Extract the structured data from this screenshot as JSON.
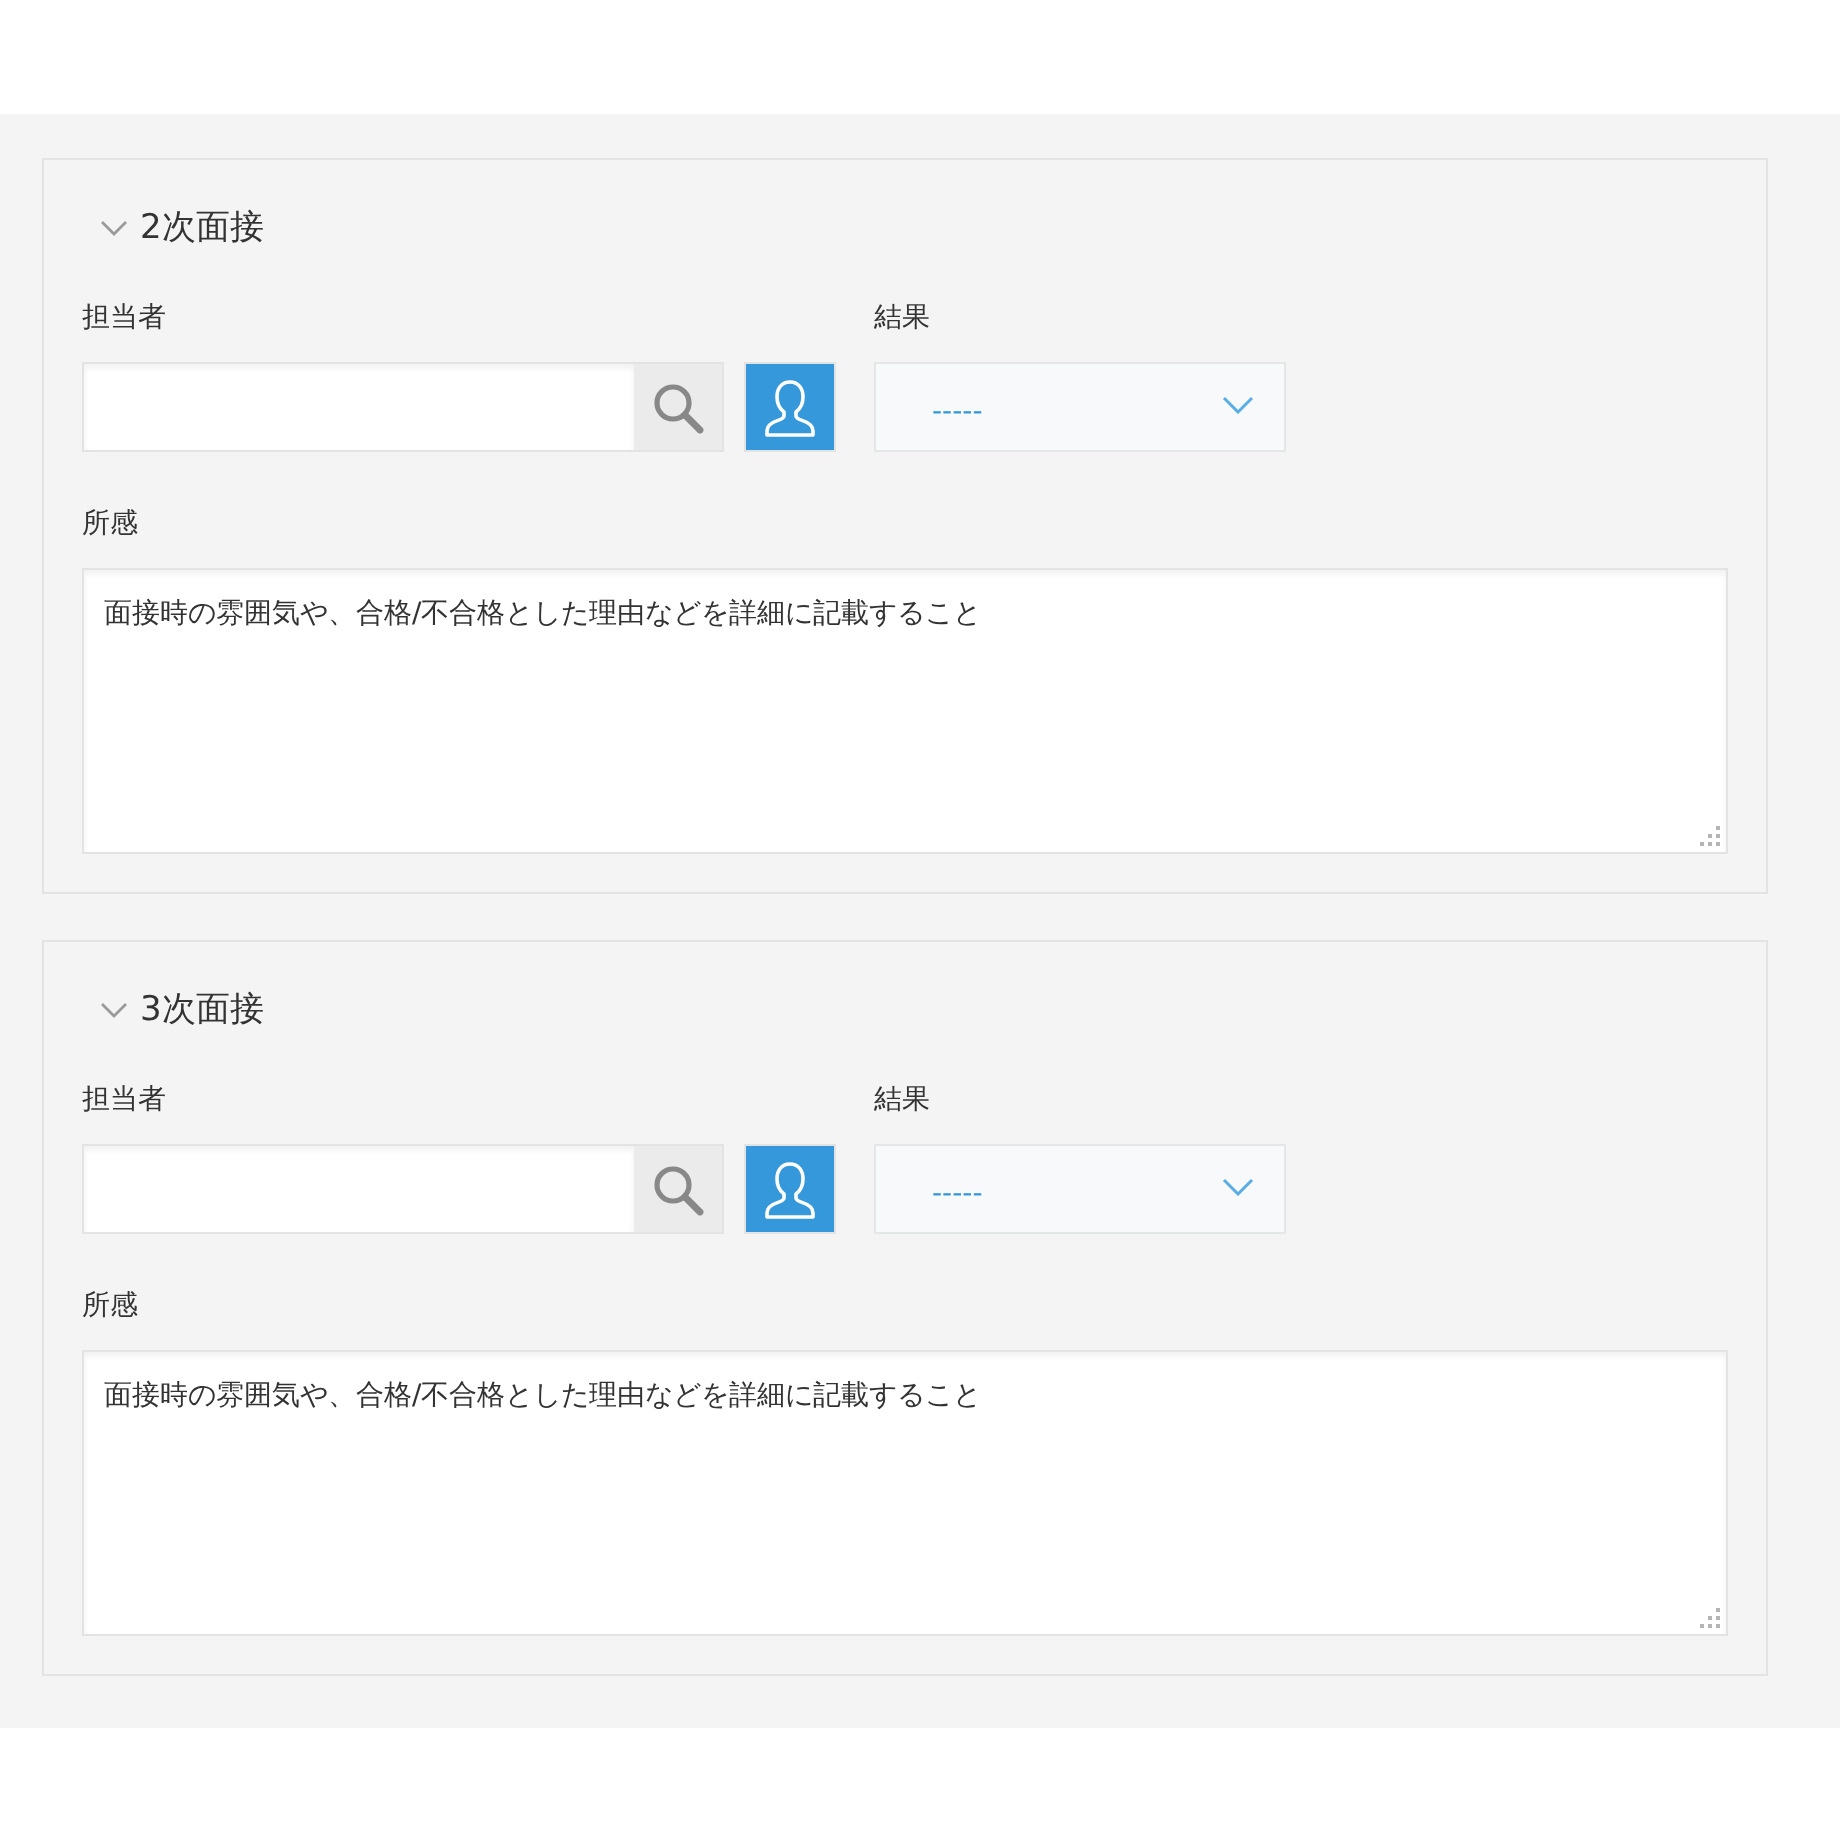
{
  "sections": [
    {
      "title": "2次面接",
      "expanded": true,
      "assignee": {
        "label": "担当者"
      },
      "result": {
        "label": "結果",
        "value": "-----"
      },
      "impression": {
        "label": "所感",
        "value": "面接時の雰囲気や、合格/不合格とした理由などを詳細に記載すること"
      }
    },
    {
      "title": "3次面接",
      "expanded": true,
      "assignee": {
        "label": "担当者"
      },
      "result": {
        "label": "結果",
        "value": "-----"
      },
      "impression": {
        "label": "所感",
        "value": "面接時の雰囲気や、合格/不合格とした理由などを詳細に記載すること"
      }
    }
  ]
}
